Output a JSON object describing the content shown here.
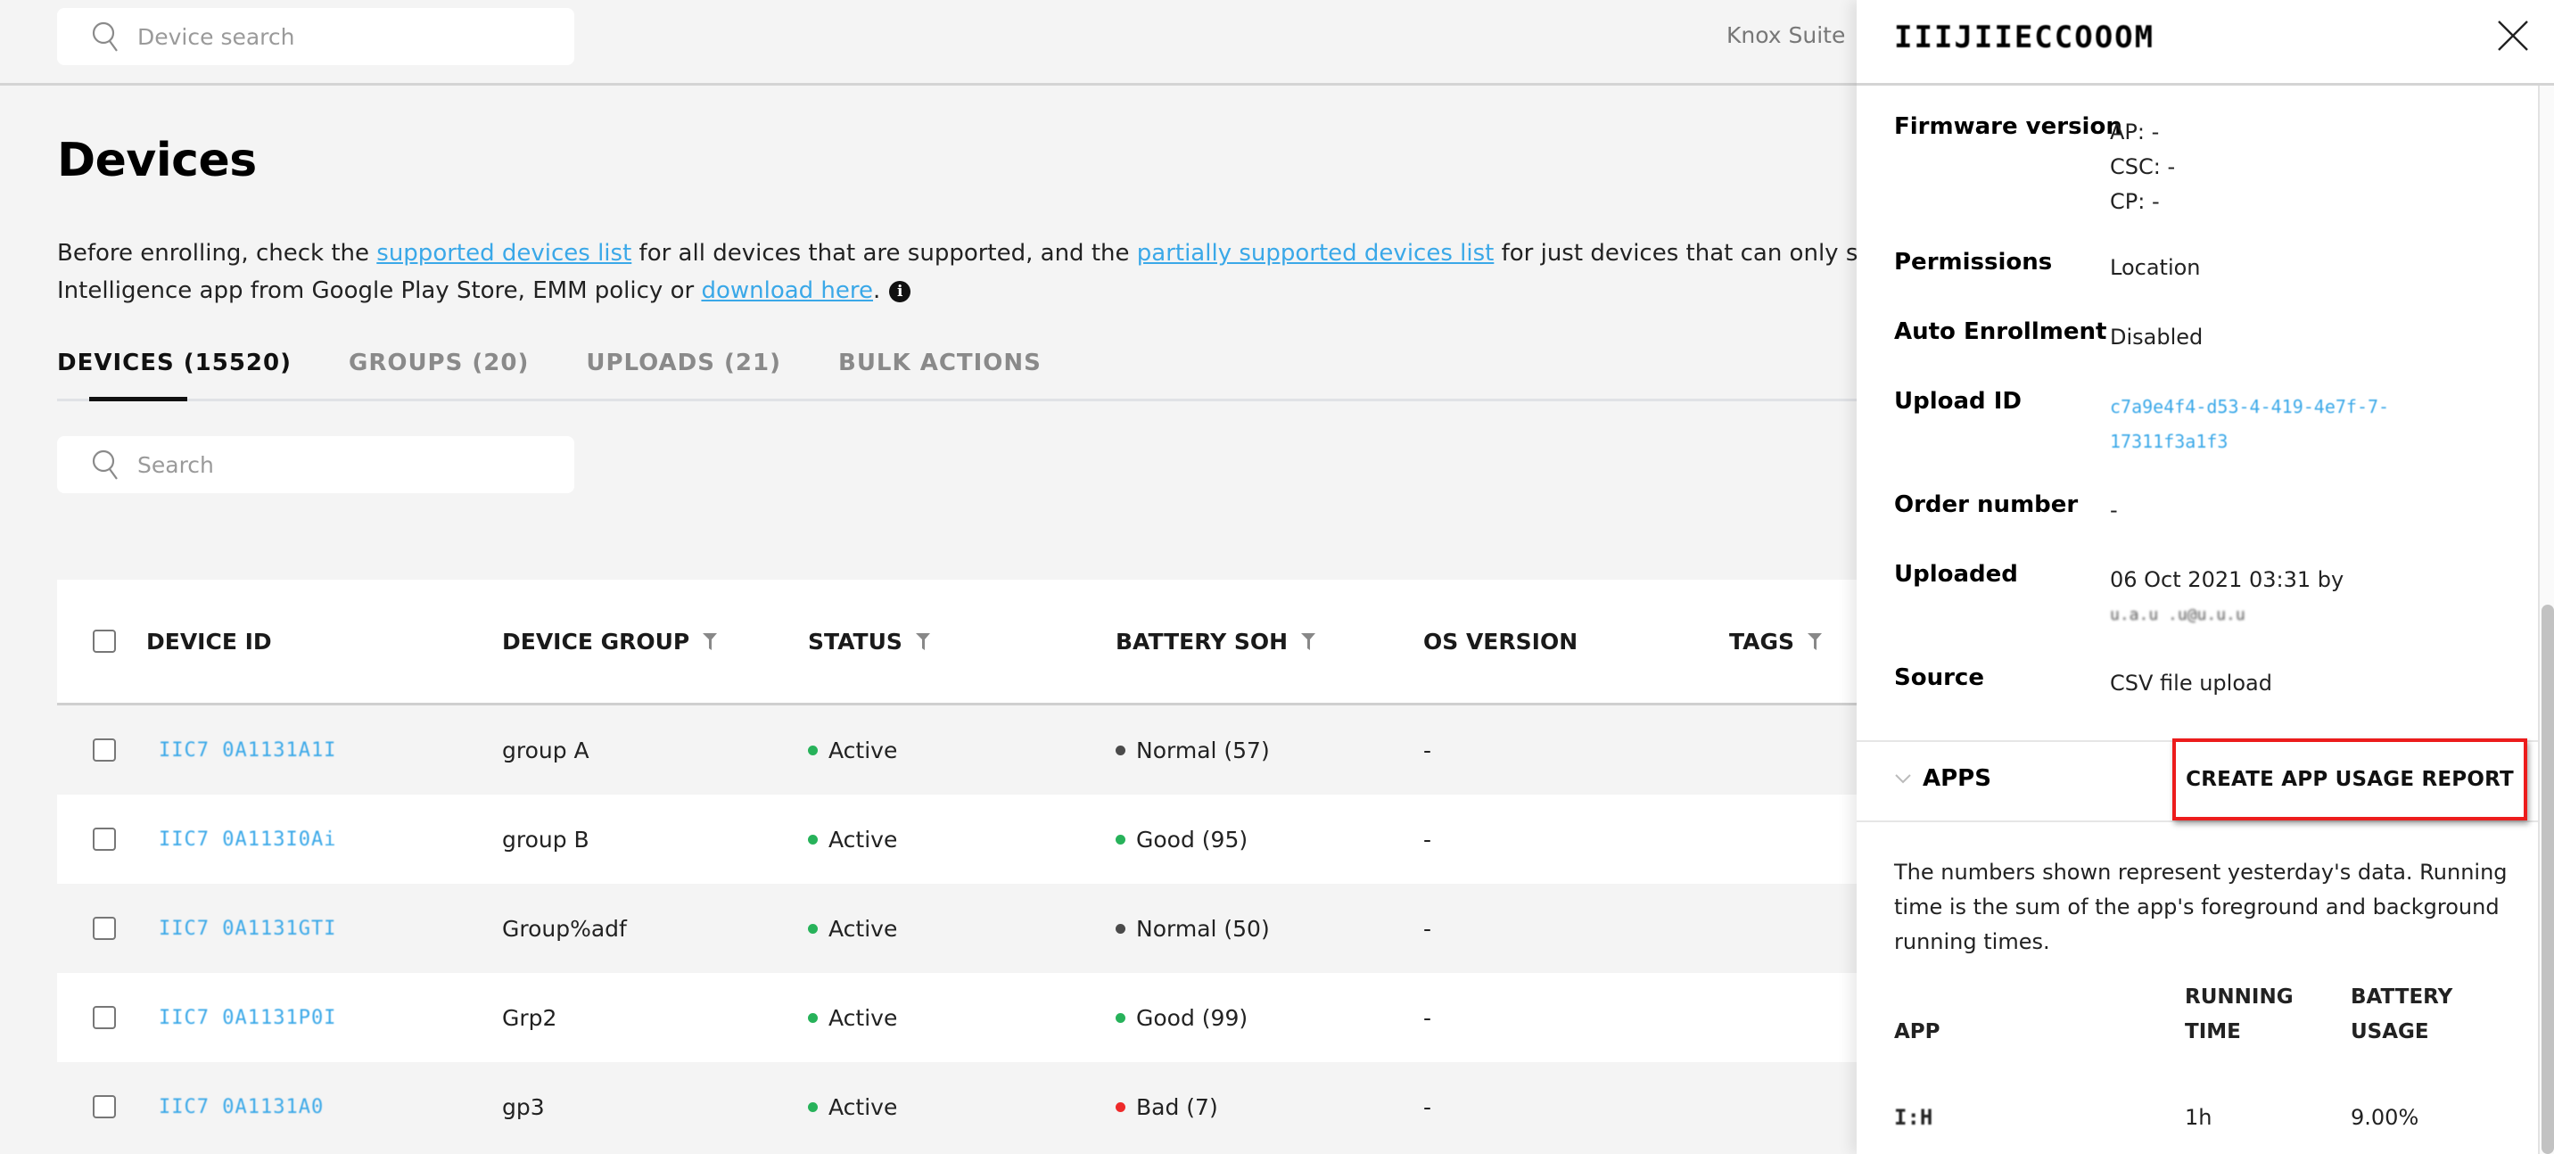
{
  "topbar": {
    "search_placeholder": "Device search",
    "breadcrumb": [
      "Knox Suite"
    ]
  },
  "page": {
    "title": "Devices",
    "description": {
      "t1": "Before enrolling, check the ",
      "link1": "supported devices list",
      "t2": " for all devices that are supported, and the ",
      "link2": "partially supported devices list",
      "t3": " for just devices that can only support cer",
      "t4": "Intelligence app from Google Play Store, EMM policy or ",
      "link3": "download here",
      "t5": ".",
      "info_icon": "i"
    },
    "tabs": [
      {
        "label": "DEVICES (15520)",
        "active": true
      },
      {
        "label": "GROUPS (20)",
        "active": false
      },
      {
        "label": "UPLOADS (21)",
        "active": false
      },
      {
        "label": "BULK ACTIONS",
        "active": false
      }
    ],
    "table_search_placeholder": "Search"
  },
  "table": {
    "columns": [
      "DEVICE ID",
      "DEVICE GROUP",
      "STATUS",
      "BATTERY SOH",
      "OS VERSION",
      "TAGS"
    ],
    "filterable": [
      false,
      true,
      true,
      true,
      false,
      true
    ],
    "rows": [
      {
        "device_id": "IIC7 0A1131A1I",
        "group": "group A",
        "status": "Active",
        "battery": "Normal (57)",
        "battery_level": "normal",
        "os": "-"
      },
      {
        "device_id": "IIC7 0A113I0Ai",
        "group": "group B",
        "status": "Active",
        "battery": "Good (95)",
        "battery_level": "good",
        "os": "-"
      },
      {
        "device_id": "IIC7 0A1131GTI",
        "group": "Group%adf",
        "status": "Active",
        "battery": "Normal (50)",
        "battery_level": "normal",
        "os": "-"
      },
      {
        "device_id": "IIC7 0A1131P0I",
        "group": "Grp2",
        "status": "Active",
        "battery": "Good (99)",
        "battery_level": "good",
        "os": "-"
      },
      {
        "device_id": "IIC7 0A1131A0",
        "group": "gp3",
        "status": "Active",
        "battery": "Bad (7)",
        "battery_level": "bad",
        "os": "-"
      }
    ]
  },
  "colors": {
    "link": "#3aa8e8",
    "active": "#27b25a",
    "good": "#27b25a",
    "normal": "#4a4a4a",
    "bad": "#ee2a2a",
    "highlight_box": "#ec1c1c"
  },
  "panel": {
    "title": "IIIJIIECCOOOM",
    "properties": [
      {
        "label": "Firmware version",
        "lines": [
          "AP: -",
          "CSC: -",
          "CP: -"
        ]
      },
      {
        "label": "Permissions",
        "lines": [
          "Location"
        ]
      },
      {
        "label": "Auto Enrollment",
        "lines": [
          "Disabled"
        ]
      },
      {
        "label": "Upload ID",
        "lines": [
          "c7a9e4f4-d53-4-419-4e7f-7-",
          "17311f3a1f3"
        ],
        "link": true
      },
      {
        "label": "Order number",
        "lines": [
          "-"
        ]
      },
      {
        "label": "Uploaded",
        "lines": [
          "06 Oct 2021 03:31 by"
        ],
        "blurred_line": "u.a.u .u@u.u.u"
      },
      {
        "label": "Source",
        "lines": [
          "CSV file upload"
        ]
      }
    ],
    "apps": {
      "title": "APPS",
      "create_report_label": "CREATE APP USAGE REPORT",
      "note": "The numbers shown represent yesterday's data. Running time is the sum of the app's foreground and background running times.",
      "columns": [
        "APP",
        "RUNNING TIME",
        "BATTERY USAGE"
      ],
      "rows": [
        {
          "app": "I:H",
          "running_time": "1h",
          "battery_usage": "9.00%"
        }
      ]
    }
  }
}
